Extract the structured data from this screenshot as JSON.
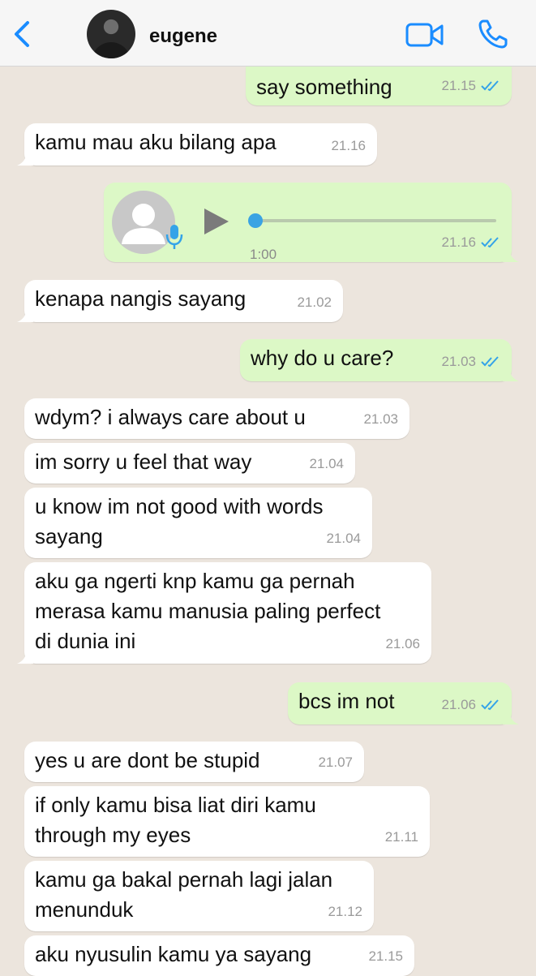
{
  "header": {
    "contact_name": "eugene",
    "back_icon": "chevron-left-icon",
    "video_icon": "video-camera-icon",
    "phone_icon": "phone-icon",
    "accent_color": "#1a8cff"
  },
  "colors": {
    "outgoing_bubble": "#dcf8c6",
    "incoming_bubble": "#ffffff",
    "chat_background": "#ece5dd",
    "read_check": "#34a3e8"
  },
  "messages": [
    {
      "direction": "out",
      "text": "say something",
      "time": "21.15",
      "read": true
    },
    {
      "direction": "in",
      "text": "kamu mau aku bilang apa",
      "time": "21.16"
    },
    {
      "direction": "out",
      "type": "voice",
      "duration": "1:00",
      "time": "21.16",
      "read": true,
      "progress": 0
    },
    {
      "direction": "in",
      "text": "kenapa nangis sayang",
      "time": "21.02"
    },
    {
      "direction": "out",
      "text": "why do u care?",
      "time": "21.03",
      "read": true
    },
    {
      "direction": "in",
      "text": "wdym? i always care about u",
      "time": "21.03"
    },
    {
      "direction": "in",
      "text": "im sorry u feel that way",
      "time": "21.04"
    },
    {
      "direction": "in",
      "text": "u know im not good with words\nsayang",
      "time": "21.04"
    },
    {
      "direction": "in",
      "text": "aku ga ngerti knp kamu ga pernah\nmerasa kamu manusia paling perfect\ndi dunia ini",
      "time": "21.06"
    },
    {
      "direction": "out",
      "text": "bcs im not",
      "time": "21.06",
      "read": true
    },
    {
      "direction": "in",
      "text": "yes u are dont be stupid",
      "time": "21.07"
    },
    {
      "direction": "in",
      "text": "if only kamu bisa liat diri kamu\nthrough my eyes",
      "time": "21.11"
    },
    {
      "direction": "in",
      "text": "kamu ga bakal pernah lagi jalan\nmenunduk",
      "time": "21.12"
    },
    {
      "direction": "in",
      "text": "aku nyusulin kamu ya sayang",
      "time": "21.15"
    }
  ]
}
